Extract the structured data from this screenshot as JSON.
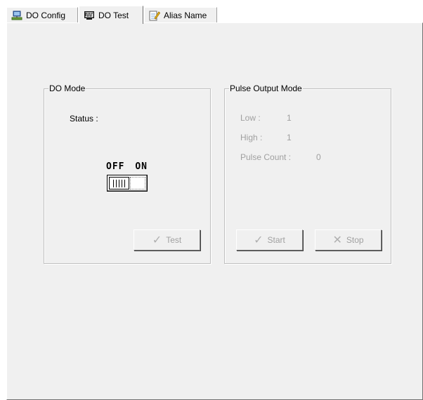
{
  "tabs": [
    {
      "label": "DO Config",
      "icon": "network-config-icon"
    },
    {
      "label": "DO Test",
      "icon": "monitor-test-icon"
    },
    {
      "label": "Alias Name",
      "icon": "notepad-pencil-icon"
    }
  ],
  "active_tab": "DO Test",
  "do_mode": {
    "title": "DO Mode",
    "status_label": "Status :",
    "switch_off_label": "OFF",
    "switch_on_label": "ON",
    "switch_state": "OFF",
    "test_button": "Test"
  },
  "pulse_mode": {
    "title": "Pulse Output Mode",
    "low_label": "Low :",
    "low_value": "1",
    "high_label": "High :",
    "high_value": "1",
    "pulse_count_label": "Pulse Count :",
    "pulse_count_value": "0",
    "start_button": "Start",
    "stop_button": "Stop"
  },
  "colors": {
    "panel_bg": "#f0f0f0",
    "disabled_text": "#a0a0a0"
  }
}
